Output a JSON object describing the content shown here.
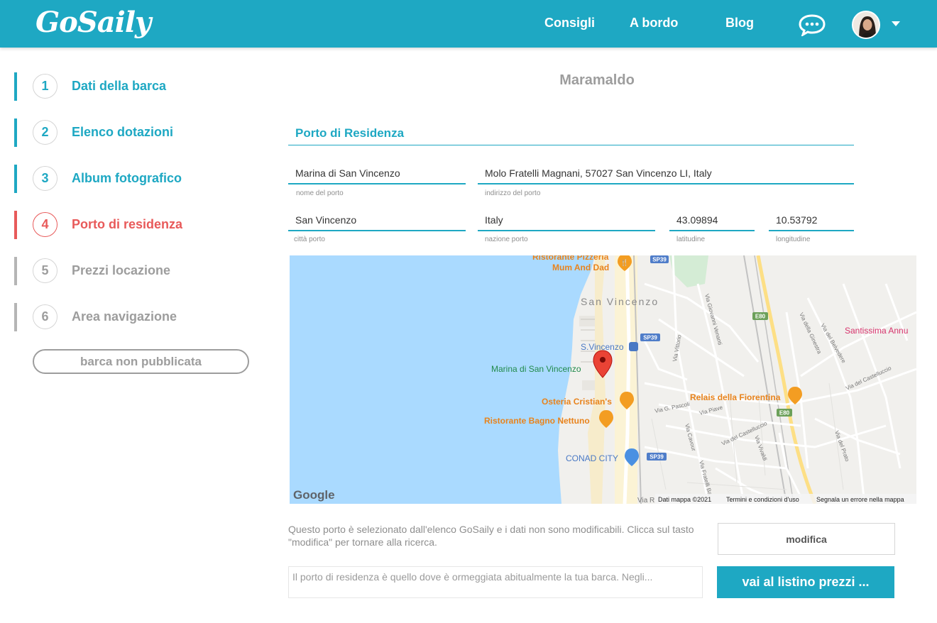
{
  "header": {
    "logo": "GoSaily",
    "nav": [
      {
        "label": "Consigli"
      },
      {
        "label": "A bordo"
      },
      {
        "label": "Blog"
      }
    ],
    "colors": {
      "brand": "#1ea8c3",
      "active_step": "#e85a5a",
      "inactive": "#9d9d9d"
    }
  },
  "sidebar": {
    "steps": [
      {
        "num": "1",
        "label": "Dati della barca",
        "state": "done"
      },
      {
        "num": "2",
        "label": "Elenco dotazioni",
        "state": "done"
      },
      {
        "num": "3",
        "label": "Album fotografico",
        "state": "done"
      },
      {
        "num": "4",
        "label": "Porto di residenza",
        "state": "active"
      },
      {
        "num": "5",
        "label": "Prezzi locazione",
        "state": "todo"
      },
      {
        "num": "6",
        "label": "Area navigazione",
        "state": "todo"
      }
    ],
    "status": "barca non pubblicata"
  },
  "main": {
    "boat_name": "Maramaldo",
    "section_title": "Porto di Residenza",
    "fields": {
      "port_name": {
        "value": "Marina di San Vincenzo",
        "caption": "nome del porto"
      },
      "port_address": {
        "value": "Molo Fratelli Magnani, 57027 San Vincenzo LI, Italy",
        "caption": "indirizzo del porto"
      },
      "city": {
        "value": "San Vincenzo",
        "caption": "città porto"
      },
      "country": {
        "value": "Italy",
        "caption": "nazione porto"
      },
      "latitude": {
        "value": "43.09894",
        "caption": "latitudine"
      },
      "longitude": {
        "value": "10.53792",
        "caption": "longitudine"
      }
    },
    "map": {
      "pois": {
        "ristorante_pizzeria_1": "Ristorante Pizzeria",
        "ristorante_pizzeria_2": "Mum And Dad",
        "town": "San Vincenzo",
        "station": "S.Vincenzo",
        "marina": "Marina di San Vincenzo",
        "osteria": "Osteria Cristian's",
        "bagno": "Ristorante Bagno Nettuno",
        "conad": "CONAD CITY",
        "relais": "Relais della Fiorentina",
        "church": "Santissima Annu"
      },
      "road_badges": {
        "sp39_a": "SP39",
        "sp39_b": "SP39",
        "sp39_c": "SP39",
        "e80_a": "E80",
        "e80_b": "E80"
      },
      "streets": {
        "via_vittorio": "Via Vittorio",
        "via_veneto": "Via Giovanni Venanti",
        "via_pascoli": "Via G. Pascoli",
        "via_piave": "Via Piave",
        "via_cavour": "Via Cavour",
        "via_castelluccio": "Via del Castelluccio",
        "via_castelluccio_2": "Via del Castelluccio",
        "via_vivaldi": "Via Vivaldi",
        "via_prato": "Via del Prato",
        "via_belvedere": "Via del Belvedere",
        "via_ginestra": "Via della Ginestra",
        "via_fratelli": "Via Fratelli Ba...",
        "via_r": "Via R"
      },
      "google": "Google",
      "footer": {
        "data": "Dati mappa ©2021",
        "terms": "Termini e condizioni d'uso",
        "report": "Segnala un errore nella mappa"
      }
    },
    "note": "Questo porto è selezionato dall'elenco GoSaily e i dati non sono modificabili. Clicca sul tasto \"modifica\" per tornare alla ricerca.",
    "modify_button": "modifica",
    "description_placeholder": "Il porto di residenza è quello dove è ormeggiata abitualmente la tua barca. Negli...",
    "next_button": "vai al listino prezzi ..."
  }
}
